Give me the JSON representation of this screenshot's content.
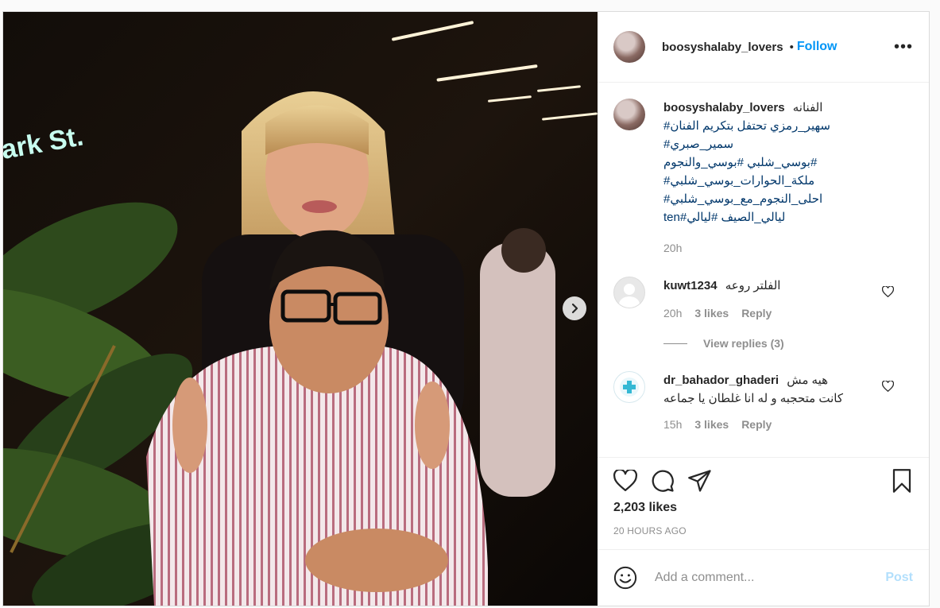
{
  "photo": {
    "sign_text": "ark St."
  },
  "header": {
    "username": "boosyshalaby_lovers",
    "separator": "•",
    "follow_label": "Follow",
    "more_label": "•••"
  },
  "caption": {
    "username": "boosyshalaby_lovers",
    "lead_text": "الفنانه",
    "hashtag_lines": [
      "#سهير_رمزي تحتفل بتكريم الفنان",
      "#سمير_صبري",
      "بوسي_شلبي #بوسي_والنجوم#",
      "#ملكة_الحوارات_بوسي_شلبي",
      "#احلى_النجوم_مع_بوسي_شلبي",
      "ten#ليالي_الصيف #ليالي"
    ],
    "time": "20h"
  },
  "comments": [
    {
      "username": "kuwt1234",
      "text_lines": [
        "الفلتر روعه"
      ],
      "time": "20h",
      "likes": "3 likes",
      "reply_label": "Reply",
      "view_replies": "View replies (3)"
    },
    {
      "username": "dr_bahador_ghaderi",
      "text_lines": [
        "هيه مش",
        "كانت متحجبه و له انا غلطان يا جماعه"
      ],
      "time": "15h",
      "likes": "3 likes",
      "reply_label": "Reply"
    }
  ],
  "actions": {
    "likes": "2,203 likes",
    "timestamp": "20 HOURS AGO"
  },
  "add_comment": {
    "placeholder": "Add a comment...",
    "post_label": "Post"
  },
  "colors": {
    "accent": "#0095f6",
    "hashtag": "#00376b",
    "muted": "#8e8e8e",
    "post_disabled": "#b2dffc"
  },
  "icons": {
    "like": "heart-icon",
    "comment": "comment-icon",
    "share": "send-icon",
    "save": "bookmark-icon",
    "emoji": "smiley-icon",
    "next": "chevron-right-icon",
    "comment_like": "heart-icon"
  }
}
